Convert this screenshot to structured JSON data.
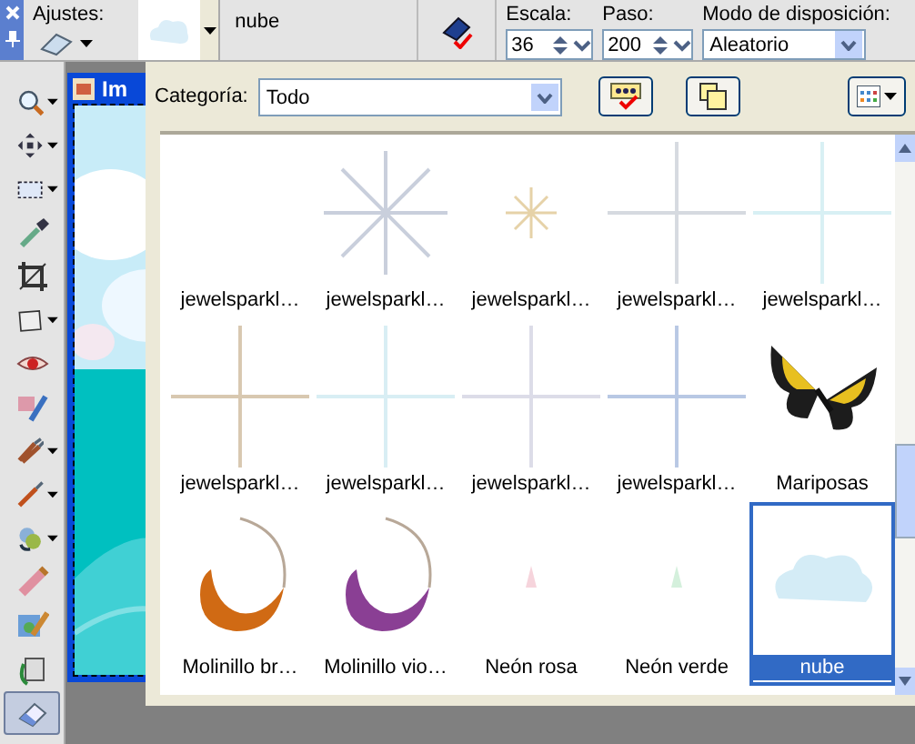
{
  "toolbar": {
    "ajustes_label": "Ajustes:",
    "brush_name": "nube",
    "escala_label": "Escala:",
    "escala": "36",
    "paso_label": "Paso:",
    "paso": "200",
    "modo_label": "Modo de disposición:",
    "modo": "Aleatorio"
  },
  "tools": [
    {
      "kind": "zoom",
      "dropdown": true,
      "selected": false
    },
    {
      "kind": "move",
      "dropdown": true,
      "selected": false
    },
    {
      "kind": "selection",
      "dropdown": true,
      "selected": false
    },
    {
      "kind": "dropper",
      "dropdown": false,
      "selected": false
    },
    {
      "kind": "crop",
      "dropdown": false,
      "selected": false
    },
    {
      "kind": "deform",
      "dropdown": true,
      "selected": false
    },
    {
      "kind": "eye",
      "dropdown": false,
      "selected": false
    },
    {
      "kind": "clone",
      "dropdown": false,
      "selected": false
    },
    {
      "kind": "brushes",
      "dropdown": true,
      "selected": false
    },
    {
      "kind": "brush",
      "dropdown": true,
      "selected": false
    },
    {
      "kind": "replacer",
      "dropdown": true,
      "selected": false
    },
    {
      "kind": "pencil",
      "dropdown": false,
      "selected": false
    },
    {
      "kind": "tube",
      "dropdown": false,
      "selected": false
    },
    {
      "kind": "fill",
      "dropdown": false,
      "selected": false
    },
    {
      "kind": "eraser",
      "dropdown": false,
      "selected": true
    }
  ],
  "document": {
    "title": "Im"
  },
  "picker": {
    "category_label": "Categoría:",
    "category": "Todo",
    "items": [
      {
        "label": "jewelsparkl…",
        "kind": "blank",
        "selected": false
      },
      {
        "label": "jewelsparkl…",
        "kind": "star",
        "color": "#c9cfdc",
        "selected": false
      },
      {
        "label": "jewelsparkl…",
        "kind": "small-star",
        "color": "#e6d2a8",
        "selected": false
      },
      {
        "label": "jewelsparkl…",
        "kind": "cross",
        "color": "#d6dae0",
        "selected": false
      },
      {
        "label": "jewelsparkl…",
        "kind": "cross",
        "color": "#d8f0f4",
        "selected": false
      },
      {
        "label": "jewelsparkl…",
        "kind": "cross",
        "color": "#d8c8b0",
        "selected": false
      },
      {
        "label": "jewelsparkl…",
        "kind": "cross",
        "color": "#d8eef4",
        "selected": false
      },
      {
        "label": "jewelsparkl…",
        "kind": "cross",
        "color": "#dcdce8",
        "selected": false
      },
      {
        "label": "jewelsparkl…",
        "kind": "cross",
        "color": "#b8c8e4",
        "selected": false
      },
      {
        "label": "Mariposas",
        "kind": "butterfly",
        "selected": false
      },
      {
        "label": "Molinillo br…",
        "kind": "swirl",
        "color": "#d06a14",
        "selected": false
      },
      {
        "label": "Molinillo vio…",
        "kind": "swirl",
        "color": "#8a3f94",
        "selected": false
      },
      {
        "label": "Neón rosa",
        "kind": "dot",
        "color": "#f6d4dc",
        "selected": false
      },
      {
        "label": "Neón verde",
        "kind": "dot",
        "color": "#d4f0dc",
        "selected": false
      },
      {
        "label": "nube",
        "kind": "cloud",
        "color": "#d4ecf6",
        "selected": true
      }
    ]
  }
}
